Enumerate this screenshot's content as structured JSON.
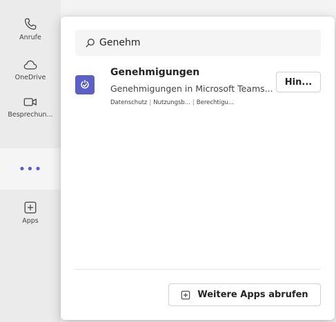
{
  "rail": {
    "items": [
      {
        "label": "Anrufe",
        "icon": "phone-icon"
      },
      {
        "label": "OneDrive",
        "icon": "cloud-icon"
      },
      {
        "label": "Besprechun...",
        "icon": "video-camera-icon"
      },
      {
        "label": "Apps",
        "icon": "add-square-icon"
      }
    ],
    "more_label": "•••"
  },
  "search": {
    "value": "Genehm",
    "icon": "search-icon"
  },
  "result": {
    "title": "Genehmigungen",
    "description": "Genehmigungen in Microsoft Teams...",
    "links": [
      "Datenschutz",
      "Nutzungsb...",
      "Berechtigu..."
    ],
    "link_separator": "|",
    "add_label": "Hin...",
    "icon": "approvals-icon",
    "accent": "#5b5fc7"
  },
  "footer": {
    "more_apps_label": "Weitere Apps abrufen",
    "icon": "add-square-icon"
  }
}
